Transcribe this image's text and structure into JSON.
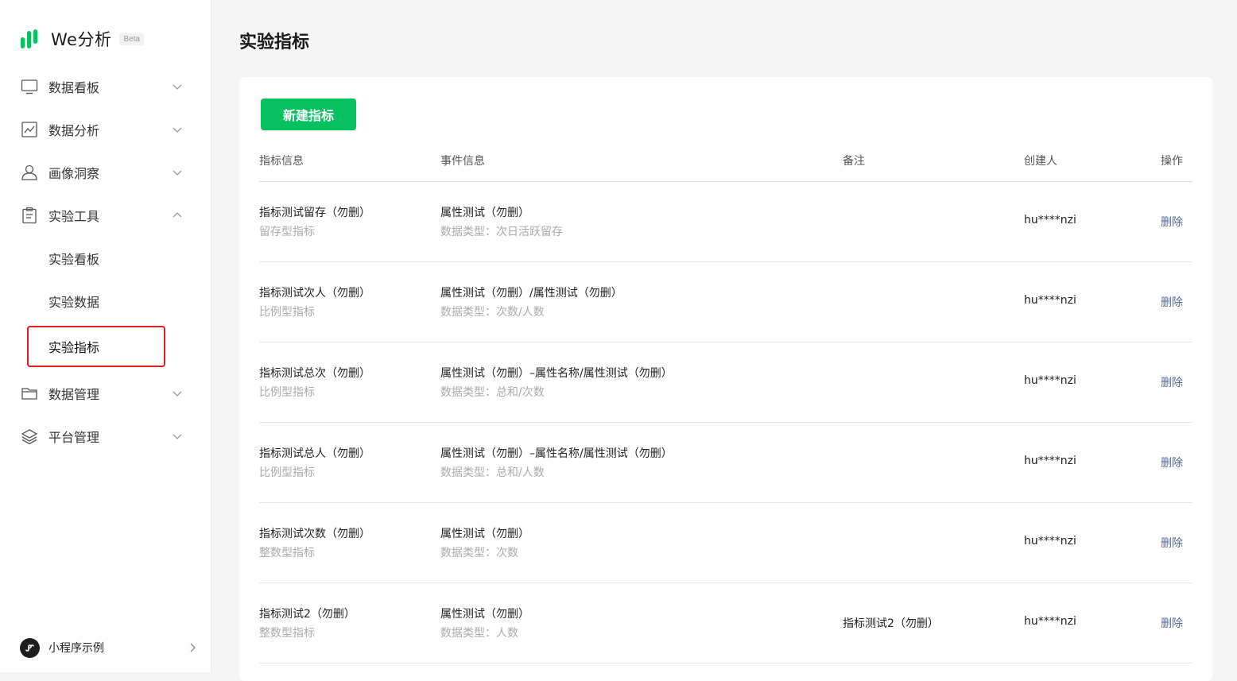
{
  "brand": {
    "name": "We分析",
    "badge": "Beta",
    "color": "#07c160"
  },
  "sidebar": {
    "items": [
      {
        "label": "数据看板",
        "icon": "monitor-icon"
      },
      {
        "label": "数据分析",
        "icon": "line-chart-icon"
      },
      {
        "label": "画像洞察",
        "icon": "user-icon"
      },
      {
        "label": "实验工具",
        "icon": "clipboard-icon",
        "expanded": true
      },
      {
        "label": "数据管理",
        "icon": "folder-icon"
      },
      {
        "label": "平台管理",
        "icon": "layers-icon"
      }
    ],
    "sub_items": [
      {
        "label": "实验看板"
      },
      {
        "label": "实验数据"
      },
      {
        "label": "实验指标",
        "active": true
      }
    ],
    "footer": {
      "label": "小程序示例"
    }
  },
  "page": {
    "title": "实验指标",
    "new_button": "新建指标"
  },
  "table": {
    "headers": {
      "metric": "指标信息",
      "event": "事件信息",
      "note": "备注",
      "creator": "创建人",
      "action": "操作"
    },
    "rows": [
      {
        "name": "指标测试留存（勿删）",
        "kind": "留存型指标",
        "event": "属性测试（勿删）",
        "data_type": "数据类型：次日活跃留存",
        "note": "",
        "creator": "hu****nzi",
        "action": "删除"
      },
      {
        "name": "指标测试次人（勿删）",
        "kind": "比例型指标",
        "event": "属性测试（勿删）/属性测试（勿删）",
        "data_type": "数据类型：次数/人数",
        "note": "",
        "creator": "hu****nzi",
        "action": "删除"
      },
      {
        "name": "指标测试总次（勿删）",
        "kind": "比例型指标",
        "event": "属性测试（勿删）–属性名称/属性测试（勿删）",
        "data_type": "数据类型：总和/次数",
        "note": "",
        "creator": "hu****nzi",
        "action": "删除"
      },
      {
        "name": "指标测试总人（勿删）",
        "kind": "比例型指标",
        "event": "属性测试（勿删）–属性名称/属性测试（勿删）",
        "data_type": "数据类型：总和/人数",
        "note": "",
        "creator": "hu****nzi",
        "action": "删除"
      },
      {
        "name": "指标测试次数（勿删）",
        "kind": "整数型指标",
        "event": "属性测试（勿删）",
        "data_type": "数据类型：次数",
        "note": "",
        "creator": "hu****nzi",
        "action": "删除"
      },
      {
        "name": "指标测试2（勿删）",
        "kind": "整数型指标",
        "event": "属性测试（勿删）",
        "data_type": "数据类型：人数",
        "note": "指标测试2（勿删）",
        "creator": "hu****nzi",
        "action": "删除"
      }
    ]
  }
}
